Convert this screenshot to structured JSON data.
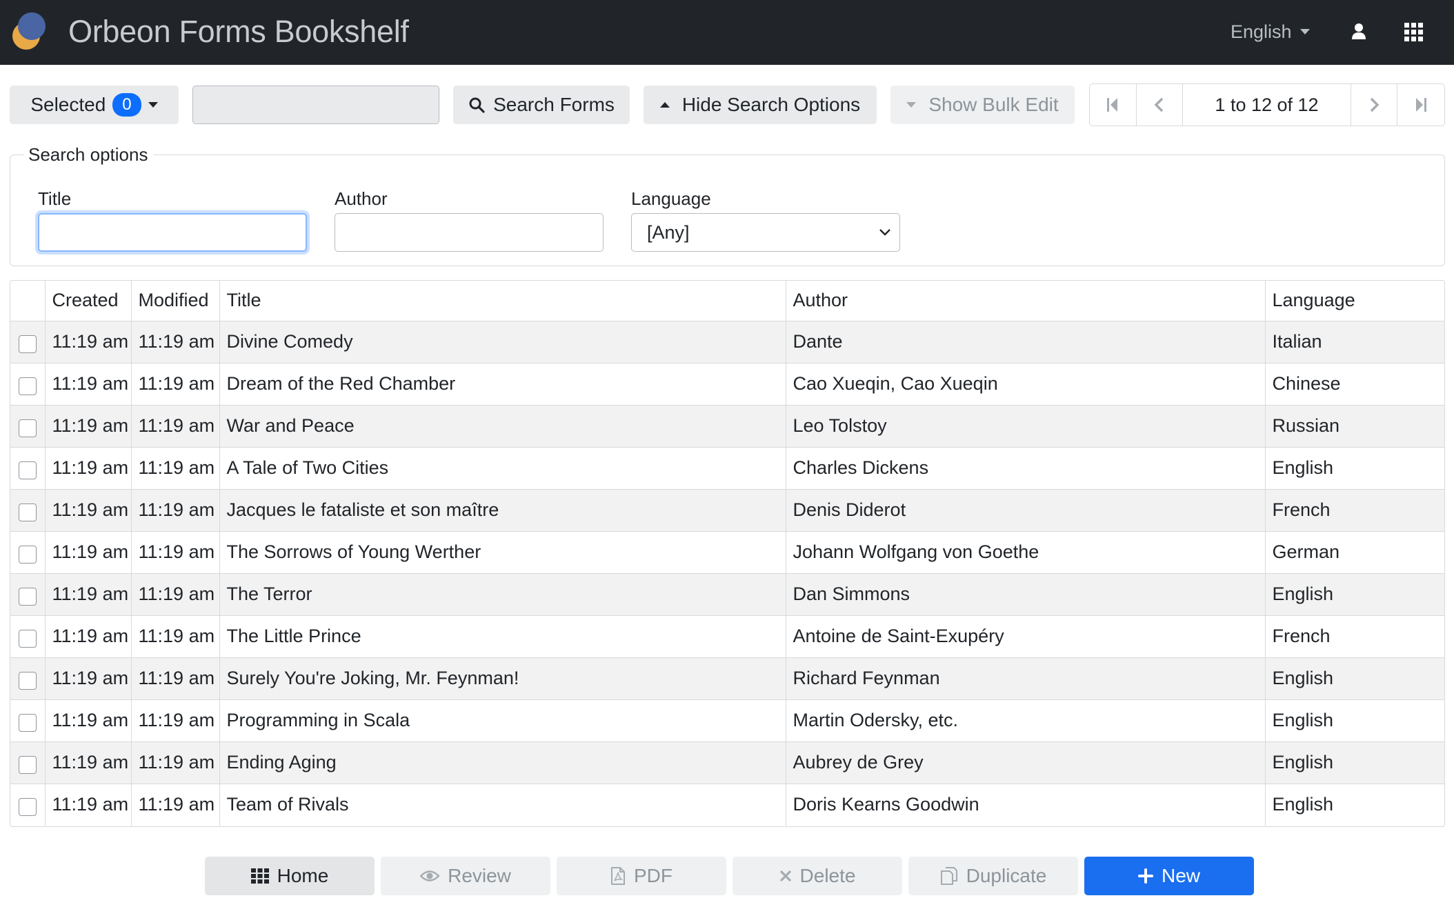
{
  "navbar": {
    "app_title": "Orbeon Forms Bookshelf",
    "language": "English",
    "brand_colors": {
      "logo_blue": "#3f5f9e",
      "logo_orange": "#e9a947"
    }
  },
  "toolbar": {
    "selected_label": "Selected",
    "selected_count": "0",
    "search_value": "",
    "search_button": "Search Forms",
    "hide_options_button": "Hide Search Options",
    "bulk_edit_button": "Show Bulk Edit",
    "pager_range": "1 to 12 of 12"
  },
  "search_options": {
    "legend": "Search options",
    "title_label": "Title",
    "title_value": "",
    "author_label": "Author",
    "author_value": "",
    "language_label": "Language",
    "language_value": "[Any]"
  },
  "table": {
    "headers": [
      "Created",
      "Modified",
      "Title",
      "Author",
      "Language"
    ],
    "rows": [
      {
        "created": "11:19 am",
        "modified": "11:19 am",
        "title": "Divine Comedy",
        "author": "Dante",
        "language": "Italian"
      },
      {
        "created": "11:19 am",
        "modified": "11:19 am",
        "title": "Dream of the Red Chamber",
        "author": "Cao Xueqin, Cao Xueqin",
        "language": "Chinese"
      },
      {
        "created": "11:19 am",
        "modified": "11:19 am",
        "title": "War and Peace",
        "author": "Leo Tolstoy",
        "language": "Russian"
      },
      {
        "created": "11:19 am",
        "modified": "11:19 am",
        "title": "A Tale of Two Cities",
        "author": "Charles Dickens",
        "language": "English"
      },
      {
        "created": "11:19 am",
        "modified": "11:19 am",
        "title": "Jacques le fataliste et son maître",
        "author": "Denis Diderot",
        "language": "French"
      },
      {
        "created": "11:19 am",
        "modified": "11:19 am",
        "title": "The Sorrows of Young Werther",
        "author": "Johann Wolfgang von Goethe",
        "language": "German"
      },
      {
        "created": "11:19 am",
        "modified": "11:19 am",
        "title": "The Terror",
        "author": "Dan Simmons",
        "language": "English"
      },
      {
        "created": "11:19 am",
        "modified": "11:19 am",
        "title": "The Little Prince",
        "author": "Antoine de Saint-Exupéry",
        "language": "French"
      },
      {
        "created": "11:19 am",
        "modified": "11:19 am",
        "title": "Surely You're Joking, Mr. Feynman!",
        "author": "Richard Feynman",
        "language": "English"
      },
      {
        "created": "11:19 am",
        "modified": "11:19 am",
        "title": "Programming in Scala",
        "author": "Martin Odersky, etc.",
        "language": "English"
      },
      {
        "created": "11:19 am",
        "modified": "11:19 am",
        "title": "Ending Aging",
        "author": "Aubrey de Grey",
        "language": "English"
      },
      {
        "created": "11:19 am",
        "modified": "11:19 am",
        "title": "Team of Rivals",
        "author": "Doris Kearns Goodwin",
        "language": "English"
      }
    ]
  },
  "bottom": {
    "home": "Home",
    "review": "Review",
    "pdf": "PDF",
    "delete": "Delete",
    "duplicate": "Duplicate",
    "new": "New"
  }
}
